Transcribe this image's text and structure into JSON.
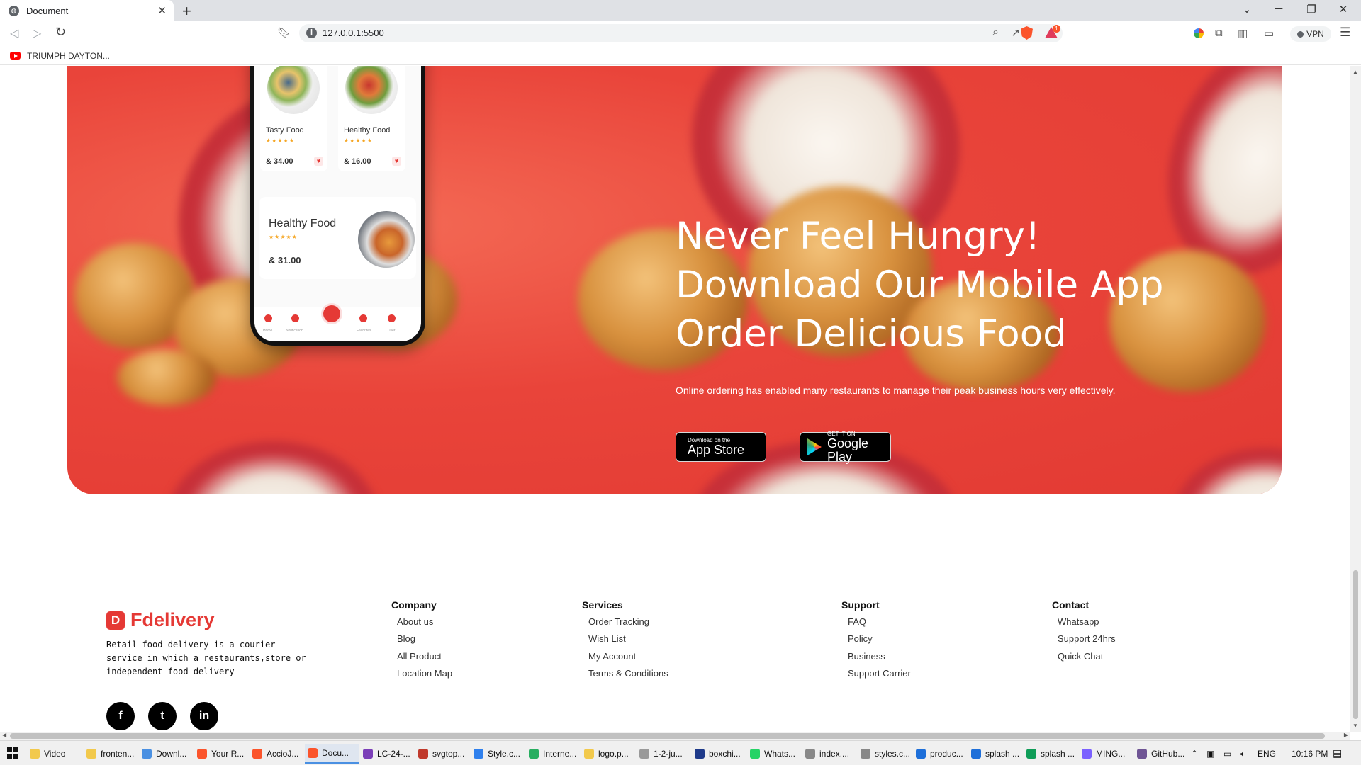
{
  "browser": {
    "tab_title": "Document",
    "url": "127.0.0.1:5500",
    "bookmark_label": "TRIUMPH DAYTON...",
    "vpn_label": "VPN",
    "rewards_count": "1"
  },
  "hero": {
    "title_line1": "Never Feel Hungry!",
    "title_line2": "Download Our Mobile App",
    "title_line3": "Order Delicious Food",
    "subtitle": "Online ordering has enabled many restaurants to manage their peak business hours very effectively.",
    "appstore_small": "Download on the",
    "appstore_big": "App Store",
    "googleplay_small": "GET IT ON",
    "googleplay_big": "Google Play"
  },
  "phone": {
    "cards": [
      {
        "name": "Tasty Food",
        "price": "& 34.00",
        "stars": "★★★★★"
      },
      {
        "name": "Healthy Food",
        "price": "& 16.00",
        "stars": "★★★★★"
      }
    ],
    "featured": {
      "name": "Healthy Food",
      "price": "& 31.00",
      "stars": "★★★★★"
    },
    "nav_labels": [
      "Home",
      "Notification",
      "Favorites",
      "User"
    ]
  },
  "footer": {
    "logo_letter": "D",
    "brand": "Fdelivery",
    "description": "Retail food delivery is a courier service in which a restaurants,store or independent food-delivery",
    "social": [
      "f",
      "t",
      "in"
    ],
    "columns": [
      {
        "title": "Company",
        "items": [
          "About us",
          "Blog",
          "All Product",
          "Location Map"
        ]
      },
      {
        "title": "Services",
        "items": [
          "Order Tracking",
          "Wish List",
          "My Account",
          "Terms & Conditions"
        ]
      },
      {
        "title": "Support",
        "items": [
          "FAQ",
          "Policy",
          "Business",
          "Support Carrier"
        ]
      },
      {
        "title": "Contact",
        "items": [
          "Whatsapp",
          "Support 24hrs",
          "Quick Chat"
        ]
      }
    ]
  },
  "taskbar": {
    "items": [
      "Video",
      "fronten...",
      "Downl...",
      "Your R...",
      "AccioJ...",
      "Docu...",
      "LC-24-...",
      "svgtop...",
      "Style.c...",
      "Interne...",
      "logo.p...",
      "1-2-ju...",
      "boxchi...",
      "Whats...",
      "index....",
      "styles.c...",
      "produc...",
      "splash ...",
      "splash ...",
      "MING...",
      "GitHub..."
    ],
    "lang": "ENG",
    "time": "10:16 PM"
  }
}
